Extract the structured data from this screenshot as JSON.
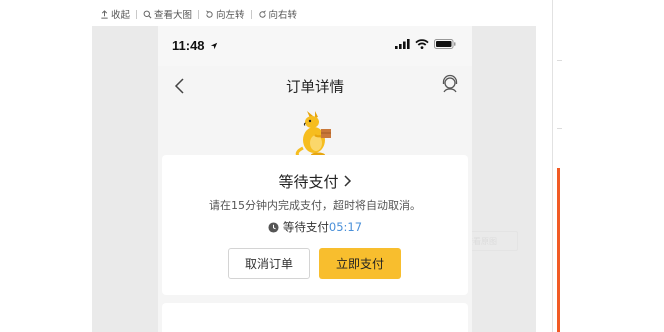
{
  "toolbar": {
    "collapse": "收起",
    "view_large": "查看大图",
    "rotate_left": "向左转",
    "rotate_right": "向右转"
  },
  "phone": {
    "status_time": "11:48",
    "nav_title": "订单详情",
    "order": {
      "status_title": "等待支付",
      "description": "请在15分钟内完成支付，超时将自动取消。",
      "countdown_label": "等待支付",
      "countdown_time": "05:17",
      "cancel_button": "取消订单",
      "pay_button": "立即支付"
    }
  },
  "ghost_label": "点击查看原图",
  "colors": {
    "accent": "#f8be2e",
    "countdown": "#4a90d9",
    "scroll_indicator": "#f15a24",
    "canvas": "#eaeaea"
  },
  "icons": [
    "collapse-icon",
    "search-icon",
    "rotate-left-icon",
    "rotate-right-icon",
    "location-arrow-icon",
    "signal-icon",
    "wifi-icon",
    "battery-icon",
    "back-icon",
    "customer-service-icon",
    "kangaroo-mascot-icon",
    "clock-icon",
    "chevron-right-icon"
  ]
}
